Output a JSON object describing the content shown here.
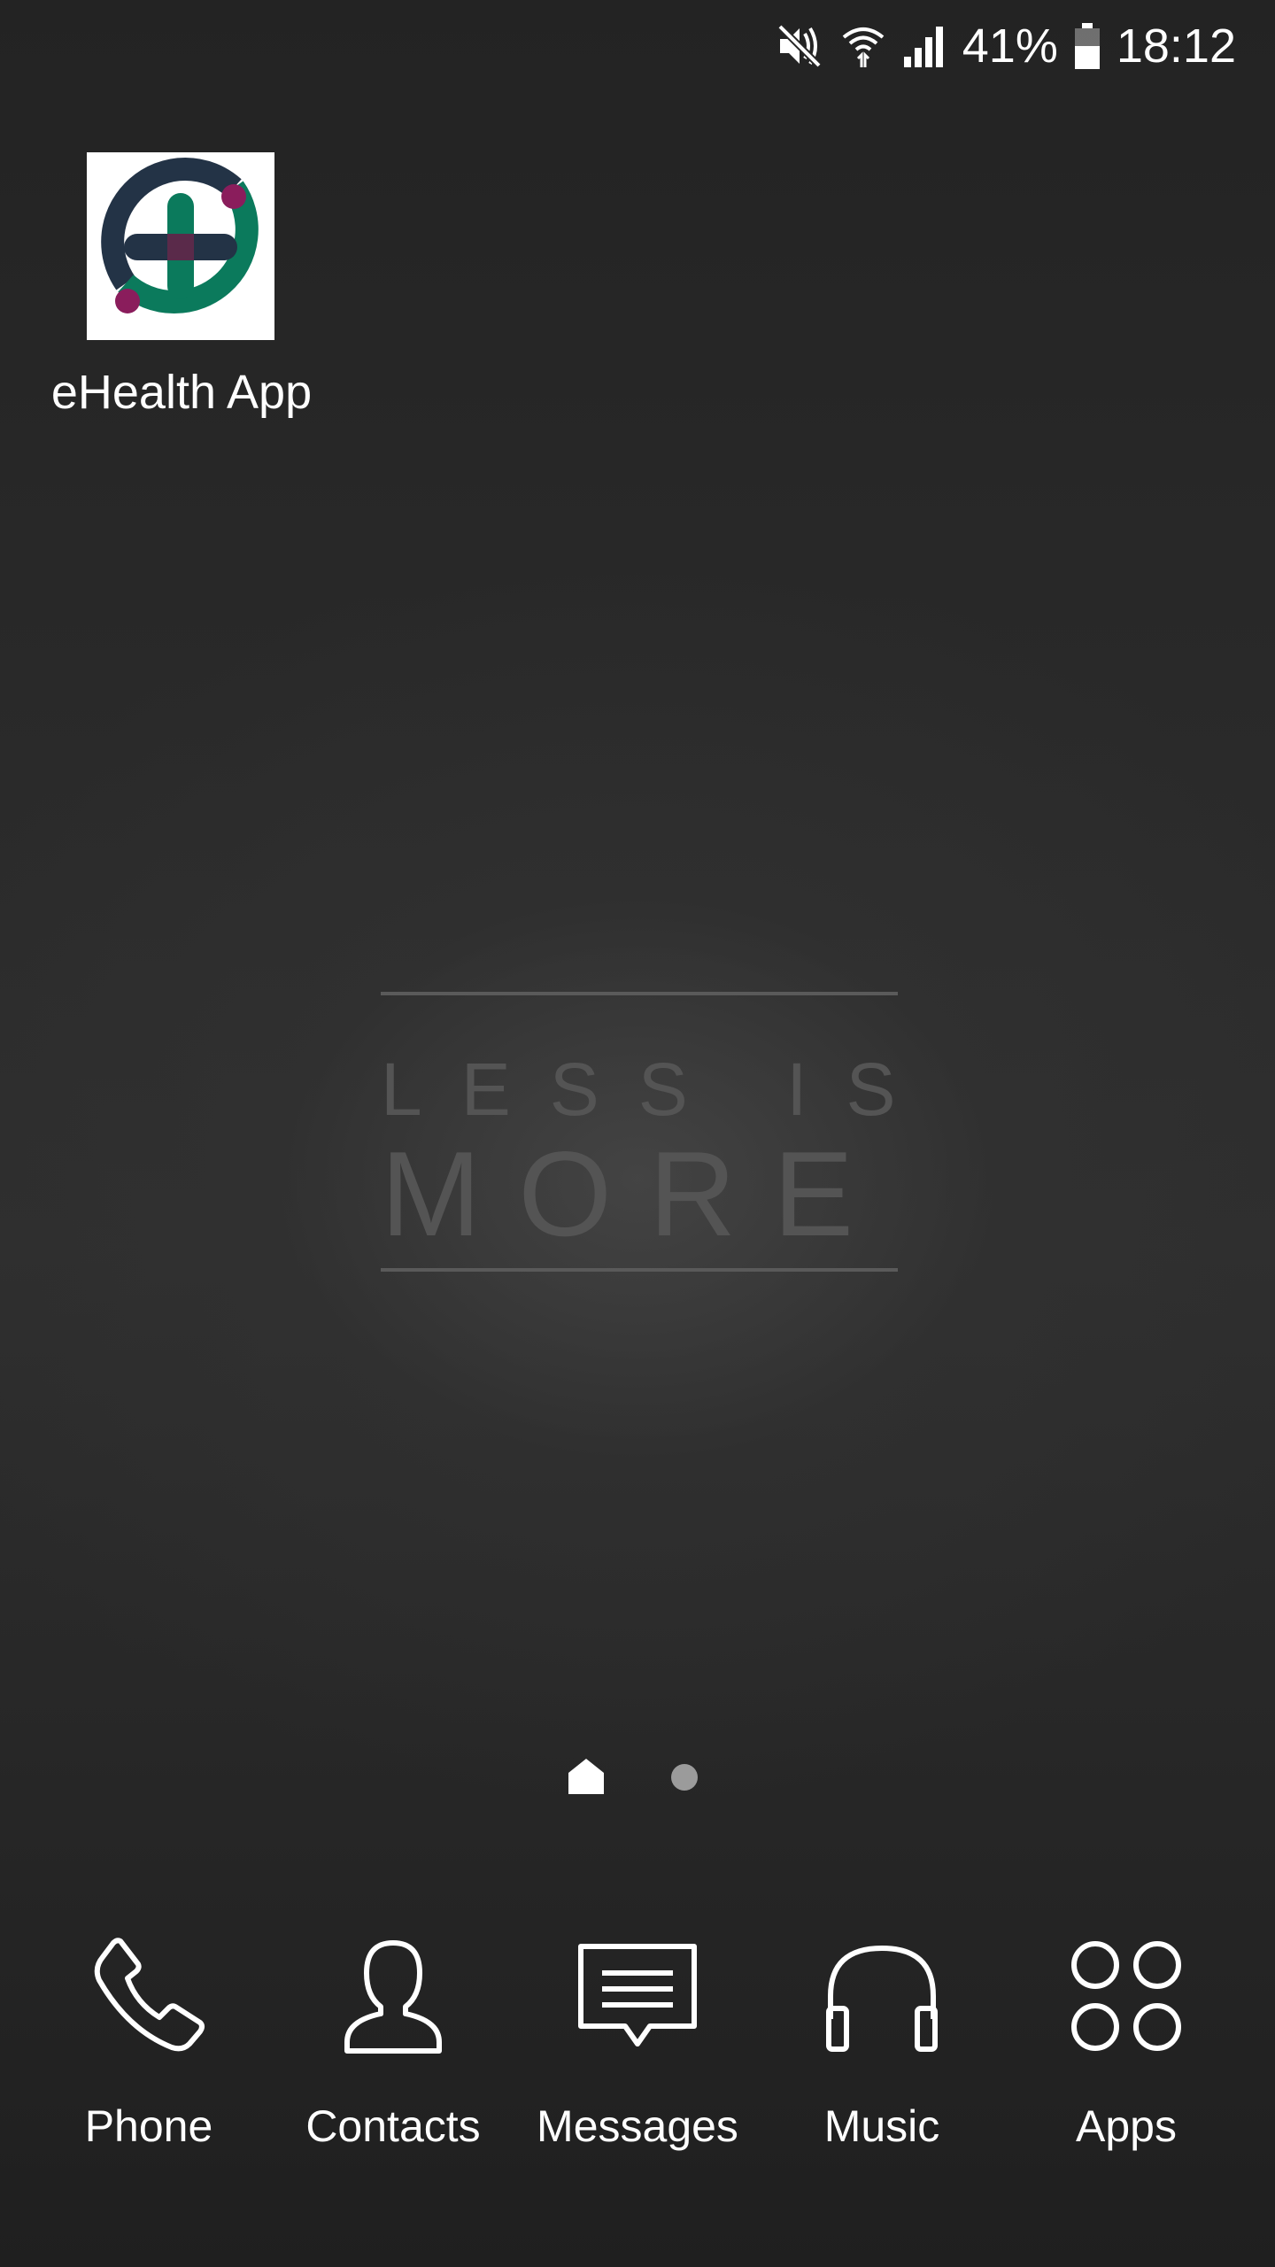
{
  "status_bar": {
    "icons": [
      "mute-icon",
      "wifi-icon",
      "signal-icon",
      "battery-icon"
    ],
    "battery": "41%",
    "time": "18:12"
  },
  "desktop": {
    "apps": [
      {
        "label": "eHealth App",
        "icon": "ehealth-app-icon"
      }
    ],
    "wallpaper_text": {
      "line1": "LESS IS",
      "line2": "MORE"
    }
  },
  "page_indicator": {
    "pages": 2,
    "current": 1
  },
  "dock": {
    "items": [
      {
        "label": "Phone",
        "icon": "phone-icon"
      },
      {
        "label": "Contacts",
        "icon": "contacts-icon"
      },
      {
        "label": "Messages",
        "icon": "messages-icon"
      },
      {
        "label": "Music",
        "icon": "headphones-icon"
      },
      {
        "label": "Apps",
        "icon": "apps-grid-icon"
      }
    ]
  },
  "colors": {
    "ehealth_navy": "#233346",
    "ehealth_green": "#0b7a5c",
    "ehealth_purple": "#8a1d5c"
  }
}
